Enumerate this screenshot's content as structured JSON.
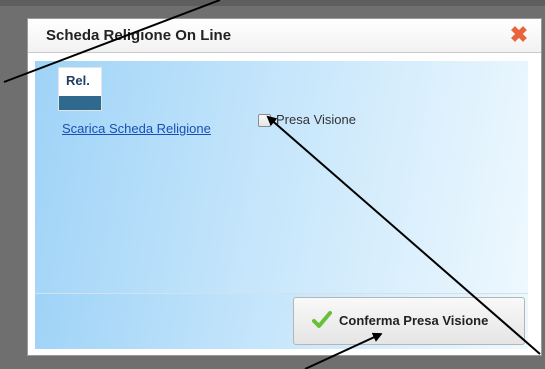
{
  "dialog": {
    "title": "Scheda Religione On Line",
    "close_icon": "close-x-icon"
  },
  "content": {
    "icon": {
      "name": "religion-document-icon",
      "label": "Rel."
    },
    "download_link": "Scarica Scheda Religione",
    "checkbox": {
      "label": "Presa Visione",
      "checked": false
    }
  },
  "footer": {
    "confirm_button": {
      "label": "Conferma Presa Visione",
      "icon": "green-checkmark-icon"
    }
  },
  "colors": {
    "close_icon": "#e8643c",
    "link": "#1a4fb5",
    "checkmark": "#6abf3a",
    "panel_gradient_start": "#9fd3f7",
    "panel_gradient_end": "#eef8fe"
  }
}
